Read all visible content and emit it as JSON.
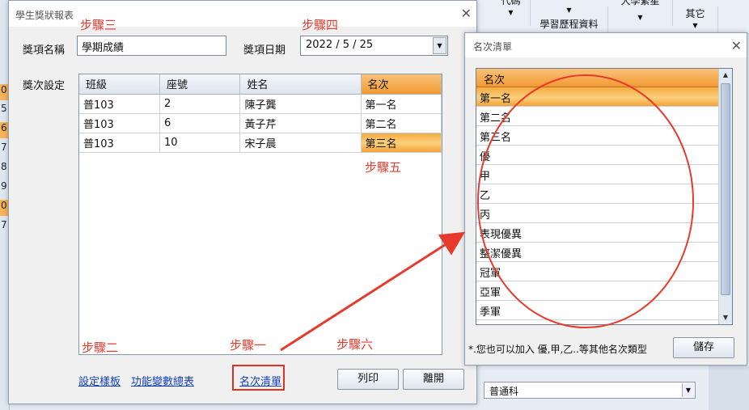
{
  "background": {
    "row_numbers": [
      "0",
      "5",
      "6",
      "7",
      "8",
      "9",
      "0",
      "7"
    ],
    "ribbon": [
      {
        "label": "代碼"
      },
      {
        "label": "學習歷程資料"
      },
      {
        "label": "大學繁星"
      },
      {
        "label": "其它"
      }
    ],
    "subject_select": "普通科"
  },
  "dialog": {
    "title": "學生獎狀報表",
    "award_name_label": "獎項名稱",
    "award_name_value": "學期成績",
    "award_date_label": "獎項日期",
    "award_date_value": "2022 / 5 / 25",
    "award_setting_label": "獎次設定",
    "grid": {
      "columns": [
        "班級",
        "座號",
        "姓名",
        "名次"
      ],
      "rows": [
        [
          "普103",
          "2",
          "陳子龔",
          "第一名"
        ],
        [
          "普103",
          "6",
          "黃子芹",
          "第二名"
        ],
        [
          "普103",
          "10",
          "宋子晨",
          "第三名"
        ]
      ]
    },
    "links": {
      "template": "設定樣板",
      "variables": "功能變數總表",
      "rank_list": "名次清單"
    },
    "buttons": {
      "print": "列印",
      "close": "離開"
    }
  },
  "annotations": {
    "step1": "步驟一",
    "step2": "步驟二",
    "step3": "步驟三",
    "step4": "步驟四",
    "step5": "步驟五",
    "step6": "步驟六",
    "color": "#e83a2c"
  },
  "rank_dialog": {
    "title": "名次清單",
    "header": "名次",
    "items": [
      "第一名",
      "第二名",
      "第三名",
      "優",
      "甲",
      "乙",
      "丙",
      "表現優異",
      "整潔優異",
      "冠軍",
      "亞軍",
      "季軍"
    ],
    "selected_index": 0,
    "note": "*.您也可以加入 優,甲,乙..等其他名次類型",
    "save_button": "儲存"
  }
}
